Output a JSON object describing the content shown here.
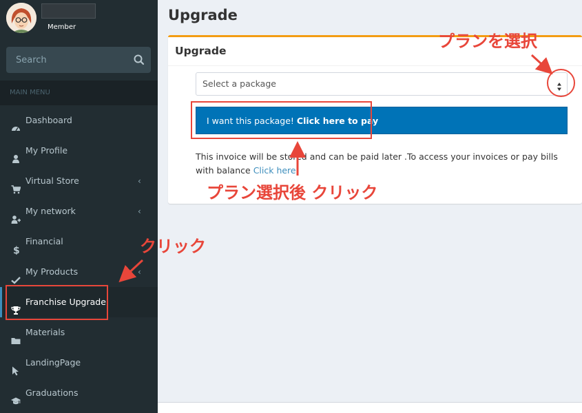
{
  "user": {
    "role": "Member"
  },
  "search": {
    "placeholder": "Search"
  },
  "menu": {
    "header": "MAIN MENU",
    "items": [
      {
        "label": "Dashboard",
        "icon": "dashboard-icon"
      },
      {
        "label": "My Profile",
        "icon": "user-icon"
      },
      {
        "label": "Virtual Store",
        "icon": "cart-icon",
        "caret": "‹"
      },
      {
        "label": "My network",
        "icon": "user-plus-icon",
        "caret": "‹"
      },
      {
        "label": "Financial",
        "icon": "dollar-icon"
      },
      {
        "label": "My Products",
        "icon": "check-icon",
        "caret": "‹"
      },
      {
        "label": "Franchise Upgrade",
        "icon": "trophy-icon",
        "active": true
      },
      {
        "label": "Materials",
        "icon": "folder-icon"
      },
      {
        "label": "LandingPage",
        "icon": "pointer-icon"
      },
      {
        "label": "Graduations",
        "icon": "graduation-cap-icon"
      }
    ]
  },
  "page": {
    "title": "Upgrade"
  },
  "box": {
    "title": "Upgrade",
    "select_value": "Select a package",
    "pay_button_prefix": "I want this package! ",
    "pay_button_bold": "Click here to pay",
    "info_text": "This invoice will be stored and can be paid later .To access your invoices or pay bills with balance ",
    "info_link": "Click here",
    "info_suffix": "."
  },
  "annotations": {
    "select_plan": "プランを選択",
    "click_after_select": "プラン選択後 クリック",
    "click": "クリック",
    "color": "#e8463a"
  },
  "colors": {
    "sidebar": "#222d32",
    "accent": "#f39c12",
    "button": "#0073b7",
    "link": "#3c8dbc"
  }
}
